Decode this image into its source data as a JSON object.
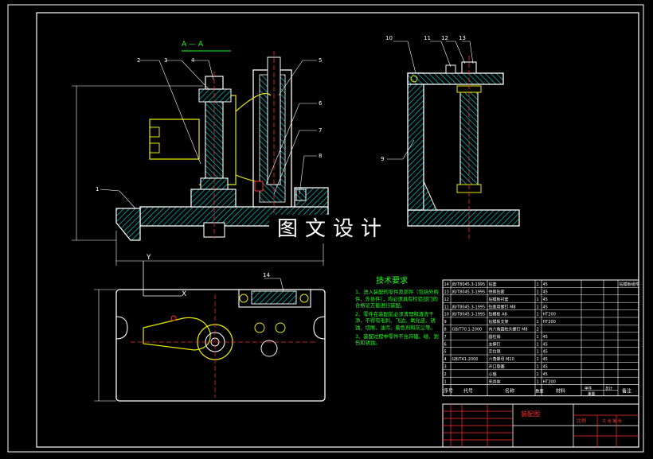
{
  "watermark": "图文设计",
  "section_label": "A — A",
  "section_letter": "A",
  "balloons": [
    "1",
    "2",
    "3",
    "4",
    "5",
    "6",
    "7",
    "8",
    "9",
    "10",
    "11",
    "12",
    "13",
    "14"
  ],
  "axis_x": "X",
  "axis_y": "Y",
  "notes": {
    "title": "技术要求",
    "items": [
      "1、进入装配的零件及部件（包括外购件、外协件），均必须具有检验部门的合格证方能进行装配。",
      "2、零件在装配前必须清理和清洗干净，不得有毛刺、飞边、氧化皮、锈蚀、切屑、油污、着色剂和灰尘等。",
      "3、装配过程中零件不允许磕、碰、划伤和锈蚀。"
    ]
  },
  "bom": {
    "headers": {
      "seq": "序号",
      "code": "代号",
      "name": "名称",
      "qty": "数量",
      "material": "材料",
      "single": "单件",
      "total": "总计",
      "weight": "重量",
      "remark": "备注"
    },
    "rows": [
      {
        "seq": "14",
        "code": "JB/T8045.3-1995",
        "name": "钻套",
        "qty": "1",
        "material": "45",
        "remark": "钻模板组件"
      },
      {
        "seq": "13",
        "code": "JB/T8045.3-1995",
        "name": "快换钻套",
        "qty": "1",
        "material": "45",
        "remark": ""
      },
      {
        "seq": "12",
        "code": "",
        "name": "钻模板衬套",
        "qty": "1",
        "material": "45",
        "remark": ""
      },
      {
        "seq": "11",
        "code": "JB/T8045.3-1995",
        "name": "钻套用螺钉 M8",
        "qty": "1",
        "material": "45",
        "remark": ""
      },
      {
        "seq": "10",
        "code": "JB/T8045.3-1995",
        "name": "钻模板 A8",
        "qty": "1",
        "material": "HT200",
        "remark": ""
      },
      {
        "seq": "9",
        "code": "",
        "name": "钻模板支架",
        "qty": "1",
        "material": "HT200",
        "remark": ""
      },
      {
        "seq": "8",
        "code": "GB/T70.1-2000",
        "name": "内六角圆柱头螺钉 M8",
        "qty": "2",
        "material": "",
        "remark": ""
      },
      {
        "seq": "7",
        "code": "",
        "name": "圆柱销",
        "qty": "1",
        "material": "45",
        "remark": ""
      },
      {
        "seq": "6",
        "code": "",
        "name": "支撑钉",
        "qty": "1",
        "material": "45",
        "remark": ""
      },
      {
        "seq": "5",
        "code": "",
        "name": "定位销",
        "qty": "1",
        "material": "45",
        "remark": ""
      },
      {
        "seq": "4",
        "code": "GB/T41-2000",
        "name": "六角螺母 M10",
        "qty": "1",
        "material": "45",
        "remark": ""
      },
      {
        "seq": "3",
        "code": "",
        "name": "开口垫圈",
        "qty": "1",
        "material": "45",
        "remark": ""
      },
      {
        "seq": "2",
        "code": "",
        "name": "心轴",
        "qty": "1",
        "material": "45",
        "remark": ""
      },
      {
        "seq": "1",
        "code": "",
        "name": "夹具体",
        "qty": "1",
        "material": "HT200",
        "remark": ""
      }
    ]
  },
  "title_block": {
    "drawing_name": "装配图",
    "scale_label": "比例",
    "sheet_label": "共 张 第 张"
  },
  "colors": {
    "outline": "#ffffff",
    "cyan": "#00c8c8",
    "yellow": "#e8e800",
    "red": "#ff3030",
    "green": "#20ff20",
    "magenta": "#ff40ff",
    "table": "#ffffff",
    "notes": "#20ff20"
  }
}
